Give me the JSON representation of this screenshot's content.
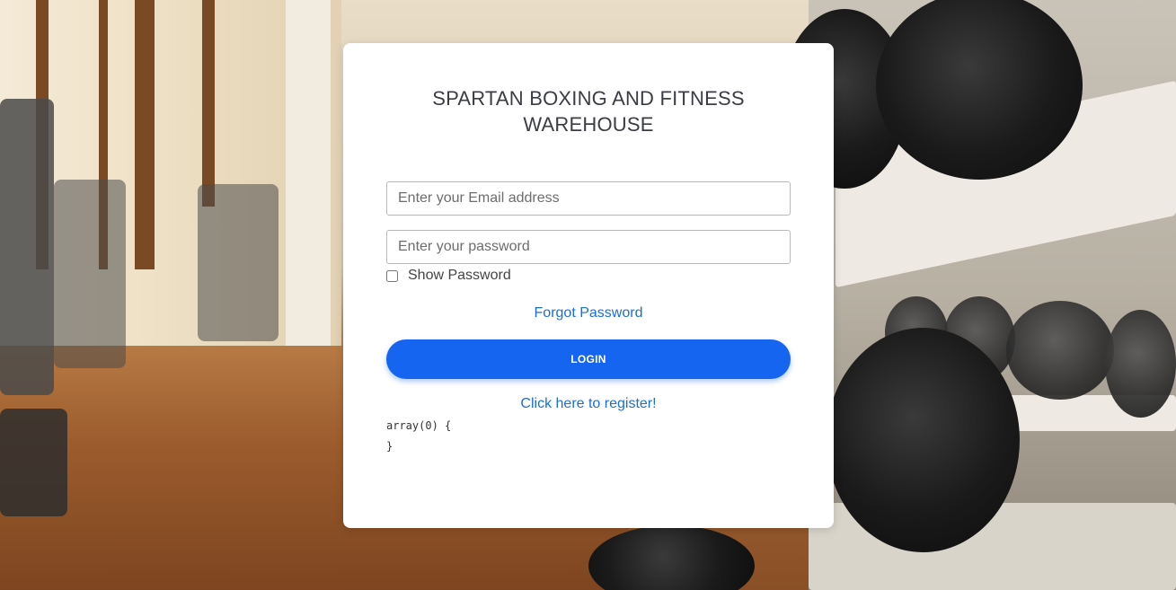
{
  "page": {
    "title": "SPARTAN BOXING AND FITNESS WAREHOUSE"
  },
  "login_form": {
    "email_placeholder": "Enter your Email address",
    "password_placeholder": "Enter your password",
    "show_password_label": "Show Password",
    "show_password_checked": false,
    "forgot_password_label": "Forgot Password",
    "login_label": "LOGIN",
    "register_label": "Click here to register!"
  },
  "debug_output": {
    "line1": "array(0) {",
    "line2": "}"
  },
  "colors": {
    "accent": "#1565f0",
    "link": "#1a6fd6",
    "title": "#3b3d45",
    "card_bg": "#ffffff"
  },
  "background": {
    "description_icon": "gym-background-image"
  }
}
